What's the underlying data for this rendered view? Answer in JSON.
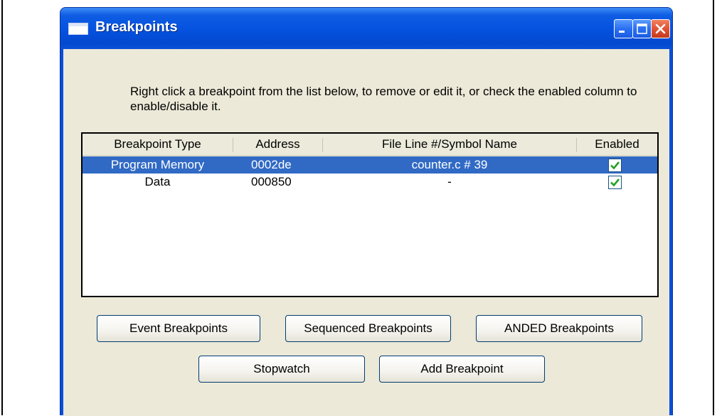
{
  "window": {
    "title": "Breakpoints",
    "icons": {
      "app": "window-icon",
      "minimize": "minimize-icon",
      "maximize": "maximize-icon",
      "close": "close-icon"
    }
  },
  "instructions": "Right click a breakpoint from the list below, to remove or edit it, or check the enabled column to enable/disable it.",
  "table": {
    "columns": [
      "Breakpoint Type",
      "Address",
      "File Line #/Symbol Name",
      "Enabled"
    ],
    "rows": [
      {
        "type": "Program Memory",
        "address": "0002de",
        "symbol": "counter.c # 39",
        "enabled": true,
        "selected": true
      },
      {
        "type": "Data",
        "address": "000850",
        "symbol": "-",
        "enabled": true,
        "selected": false
      }
    ]
  },
  "buttons": {
    "event": "Event Breakpoints",
    "sequenced": "Sequenced Breakpoints",
    "anded": "ANDED Breakpoints",
    "stopwatch": "Stopwatch",
    "add": "Add Breakpoint"
  },
  "colors": {
    "titlebar": "#0553e0",
    "selection": "#316ac5",
    "dialog_bg": "#ece9d8",
    "close_button": "#e35234",
    "check": "#21a121"
  }
}
